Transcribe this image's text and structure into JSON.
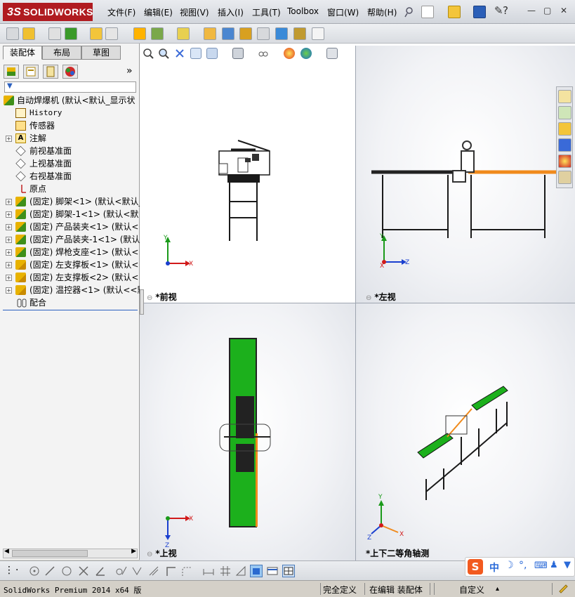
{
  "app": {
    "logo_text": "SOLIDWORKS",
    "logo_prefix": "3S"
  },
  "menu": [
    {
      "label": "文件(F)"
    },
    {
      "label": "编辑(E)"
    },
    {
      "label": "视图(V)"
    },
    {
      "label": "插入(I)"
    },
    {
      "label": "工具(T)"
    },
    {
      "label": "Toolbox"
    },
    {
      "label": "窗口(W)"
    },
    {
      "label": "帮助(H)"
    }
  ],
  "panel": {
    "tabs": [
      "装配体",
      "布局",
      "草图"
    ],
    "expand_glyph": "»",
    "filter_glyph": "▼"
  },
  "tree": {
    "root": "自动焊爆机  (默认<默认_显示状",
    "history": "History",
    "sensors": "传感器",
    "annotations": "注解",
    "front_plane": "前视基准面",
    "top_plane": "上视基准面",
    "right_plane": "右视基准面",
    "origin": "原点",
    "components": [
      "(固定) 脚架<1> (默认<默认_",
      "(固定) 脚架-1<1> (默认<默",
      "(固定) 产品装夹<1> (默认<",
      "(固定) 产品装夹-1<1> (默认",
      "(固定) 焊枪支座<1> (默认<",
      "(固定) 左支撑板<1> (默认<",
      "(固定) 左支撑板<2> (默认<",
      "(固定) 温控器<1> (默认<<默"
    ],
    "mates": "配合"
  },
  "views": {
    "front": "*前视",
    "left": "*左视",
    "top": "*上视",
    "iso": "*上下二等角轴测"
  },
  "axes": {
    "x": "X",
    "y": "Y",
    "z": "Z"
  },
  "status": {
    "product": "SolidWorks Premium 2014 x64 版",
    "defined": "完全定义",
    "editing": "在编辑 装配体",
    "custom": "自定义",
    "caret": "▴"
  },
  "ime": {
    "mode": "中"
  },
  "colors": {
    "accent_red": "#b01b20",
    "belt_green": "#1cb01c",
    "belt_orange": "#f08a1c",
    "axis_red": "#d11a1a",
    "axis_green": "#1a9a1a",
    "axis_blue": "#1a3fcf"
  }
}
